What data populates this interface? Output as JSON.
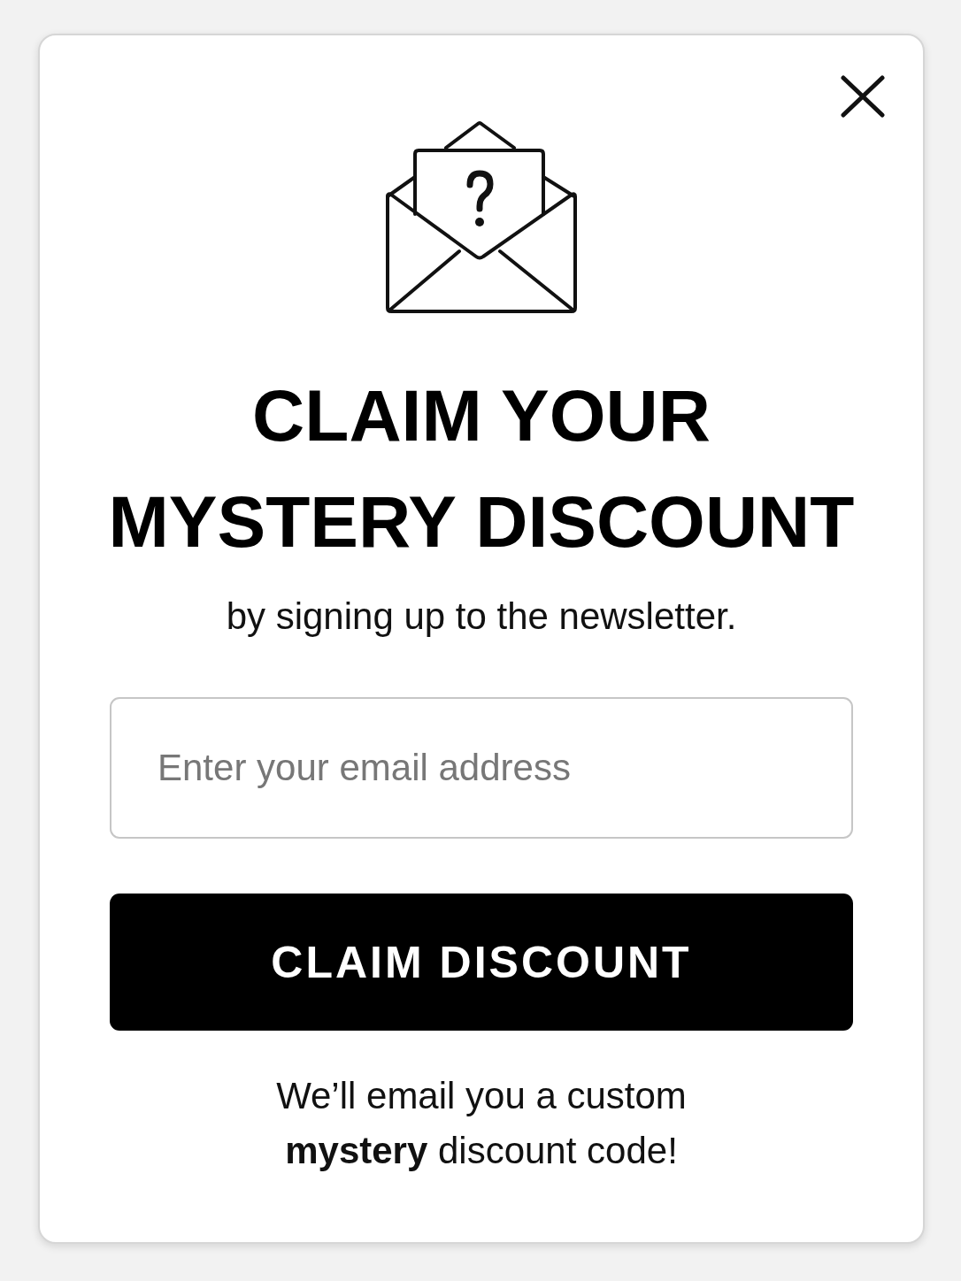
{
  "popup": {
    "title": "CLAIM YOUR MYSTERY DISCOUNT",
    "subtitle": "by signing up to the newsletter.",
    "email_field": {
      "placeholder": "Enter your email address"
    },
    "submit_button": "CLAIM DISCOUNT",
    "note": "We’ll email you a custom **mystery** discount code!"
  }
}
